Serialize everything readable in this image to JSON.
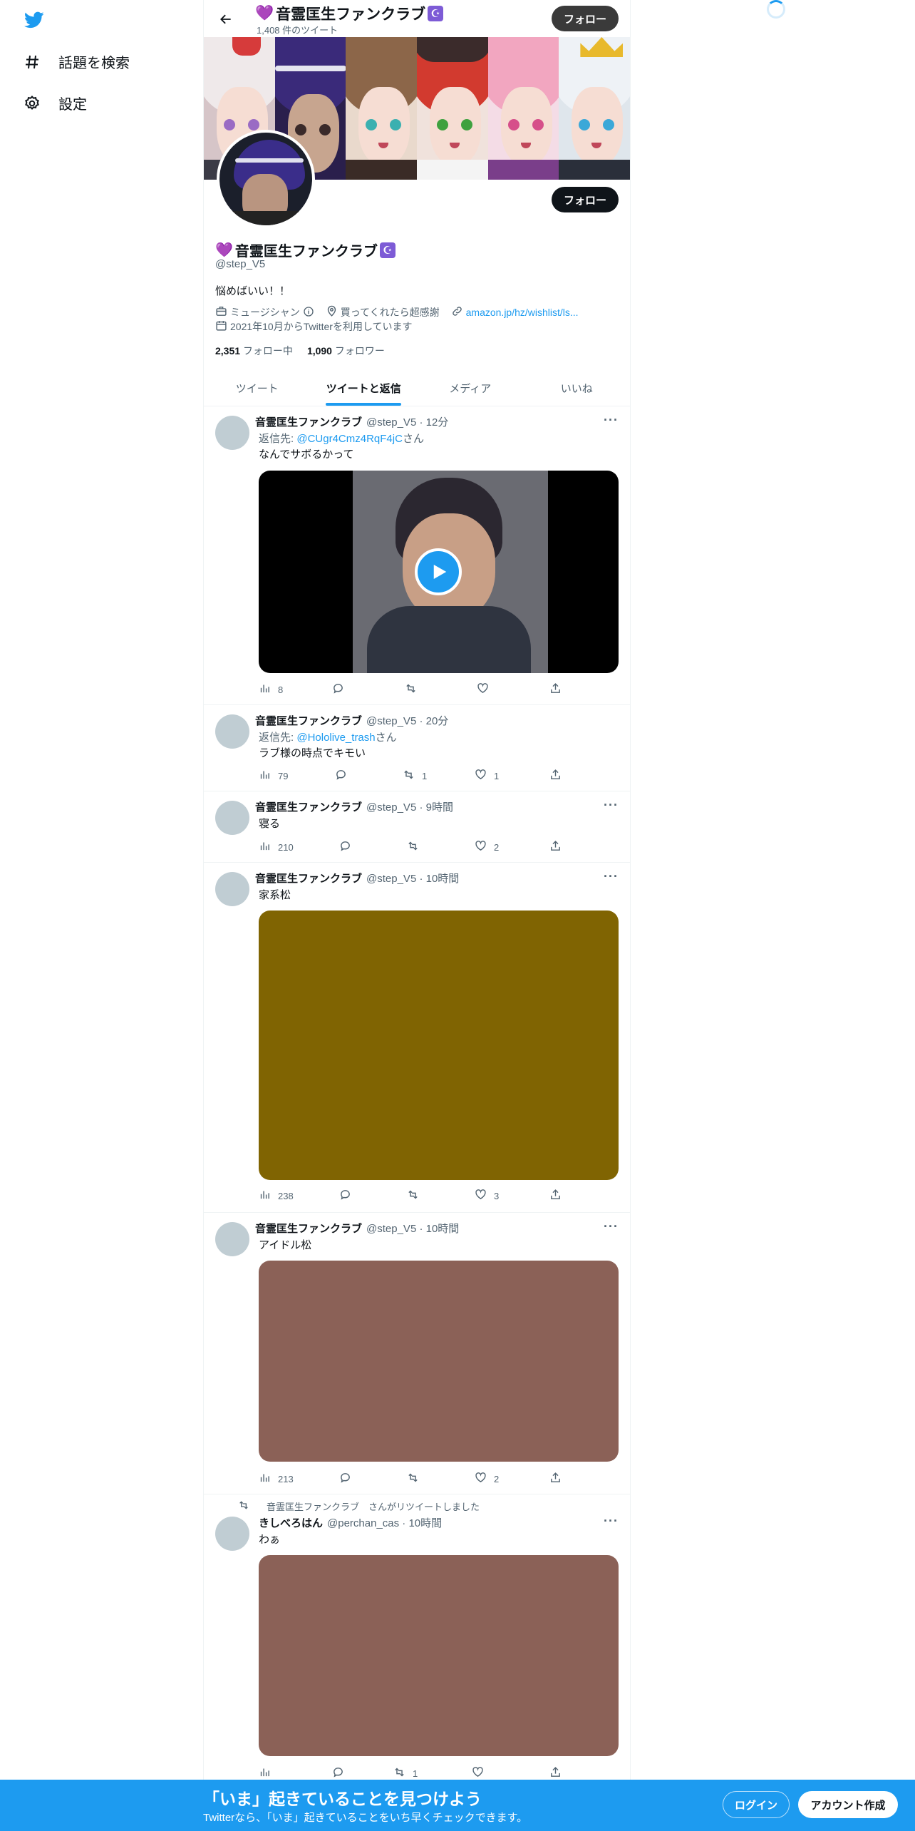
{
  "nav": {
    "explore_label": "話題を検索",
    "settings_label": "設定"
  },
  "profile": {
    "heart": "💜",
    "name": "音霊匡生ファンクラブ",
    "badge": "☪",
    "tweet_count": "1,408 件のツイート",
    "follow_label": "フォロー",
    "handle": "@step_V5",
    "bio": "悩めばいい！！",
    "category": "ミュージシャン",
    "location": "買ってくれたら超感謝",
    "url": "amazon.jp/hz/wishlist/ls...",
    "joined": "2021年10月からTwitterを利用しています",
    "following_count": "2,351",
    "following_label": "フォロー中",
    "followers_count": "1,090",
    "followers_label": "フォロワー"
  },
  "tabs": [
    {
      "label": "ツイート",
      "active": false
    },
    {
      "label": "ツイートと返信",
      "active": true
    },
    {
      "label": "メディア",
      "active": false
    },
    {
      "label": "いいね",
      "active": false
    }
  ],
  "tweets": [
    {
      "name": "音霊匡生ファンクラブ",
      "handle_time": "@step_V5 · 12分",
      "reply_prefix": "返信先: ",
      "reply_to": "@CUgr4Cmz4RqF4jC",
      "reply_suffix": "さん",
      "text": "なんでサボるかって",
      "views": "8",
      "replies": "",
      "retweets": "",
      "likes": ""
    },
    {
      "name": "音霊匡生ファンクラブ",
      "handle_time": "@step_V5 · 20分",
      "reply_prefix": "返信先: ",
      "reply_to": "@Hololive_trash",
      "reply_suffix": "さん",
      "text": "ラブ様の時点でキモい",
      "views": "79",
      "replies": "",
      "retweets": "1",
      "likes": "1"
    },
    {
      "name": "音霊匡生ファンクラブ",
      "handle_time": "@step_V5 · 9時間",
      "text": "寝る",
      "views": "210",
      "replies": "",
      "retweets": "",
      "likes": "2"
    },
    {
      "name": "音霊匡生ファンクラブ",
      "handle_time": "@step_V5 · 10時間",
      "text": "家系松",
      "media_color": "#806402",
      "views": "238",
      "replies": "",
      "retweets": "",
      "likes": "3"
    },
    {
      "name": "音霊匡生ファンクラブ",
      "handle_time": "@step_V5 · 10時間",
      "text": "アイドル松",
      "media_color": "#8b6157",
      "views": "213",
      "replies": "",
      "retweets": "",
      "likes": "2"
    },
    {
      "retweeted_by": "音霊匡生ファンクラブ",
      "retweeted_label": "さんがリツイートしました",
      "name": "きしべろはん",
      "handle_time": "@perchan_cas · 10時間",
      "text": "わぁ",
      "media_color": "#8b6157",
      "views": "",
      "replies": "",
      "retweets": "1",
      "likes": ""
    }
  ],
  "more_label": "···",
  "bottom": {
    "title": "「いま」起きていることを見つけよう",
    "subtitle": "Twitterなら、「いま」起きていることをいち早くチェックできます。",
    "login_label": "ログイン",
    "signup_label": "アカウント作成"
  },
  "colors": {
    "accent": "#1d9bf0",
    "badge": "#7d5bd6"
  }
}
